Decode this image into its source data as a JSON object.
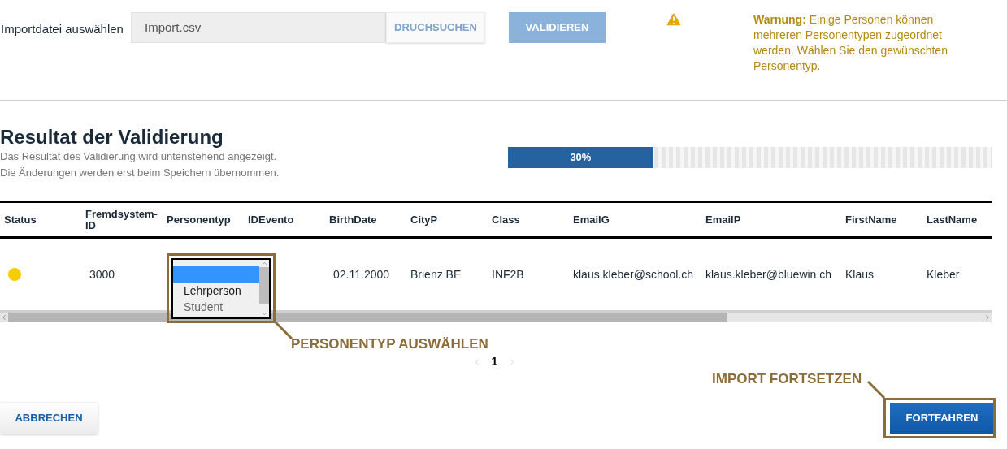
{
  "import": {
    "label": "Importdatei auswählen",
    "file_value": "Import.csv",
    "browse_button": "DRUCHSUCHEN",
    "validate_button": {
      "label": "VALIDIEREN",
      "disabled": true
    }
  },
  "warning": {
    "text": "**Warnung:** Einige Personen können mehreren Personentypen zugeordnet werden. Wählen Sie den gewünschten Personentyp."
  },
  "result": {
    "title": "Resultat der Validierung",
    "subtitle_lines": [
      "Das Resultat des Validierung wird untenstehend angezeigt.",
      "Die Änderungen werden erst beim Speichern übernommen."
    ]
  },
  "progress": {
    "level": 0.3,
    "label": "30%"
  },
  "table": {
    "columns": [
      "Status",
      "Fremdsystem-ID",
      "Personentyp",
      "IDEvento",
      "BirthDate",
      "CityP",
      "Class",
      "EmailG",
      "EmailP",
      "FirstName",
      "LastName"
    ],
    "rows": [
      {
        "cells": [
          {
            "kind": "status",
            "color": "#f7cc00"
          },
          {
            "kind": "text",
            "text": "3000"
          },
          {
            "kind": "select",
            "options": [
              {
                "selected": true,
                "disabled": false
              },
              {
                "label": "Lehrperson",
                "selected": false,
                "disabled": false
              },
              {
                "label": "Student",
                "selected": false,
                "disabled": true
              }
            ]
          },
          {
            "kind": "covered"
          },
          {
            "kind": "text",
            "text": "02.11.2000"
          },
          {
            "kind": "text",
            "text": "Brienz BE"
          },
          {
            "kind": "text",
            "text": "INF2B"
          },
          {
            "kind": "text",
            "text": "klaus.kleber@school.ch"
          },
          {
            "kind": "text",
            "text": "klaus.kleber@bluewin.ch"
          },
          {
            "kind": "text",
            "text": "Klaus"
          },
          {
            "kind": "text",
            "text": "Kleber"
          }
        ]
      }
    ]
  },
  "pagination": {
    "prev_disabled": true,
    "page": "1",
    "next_disabled": true
  },
  "annotations": [
    {
      "text": "PERSONENTYP AUSWÄHLEN"
    },
    {
      "text": "IMPORT FORTSETZEN"
    }
  ],
  "buttons": {
    "cancel": "ABBRECHEN",
    "continue": "FORTFAHREN"
  }
}
